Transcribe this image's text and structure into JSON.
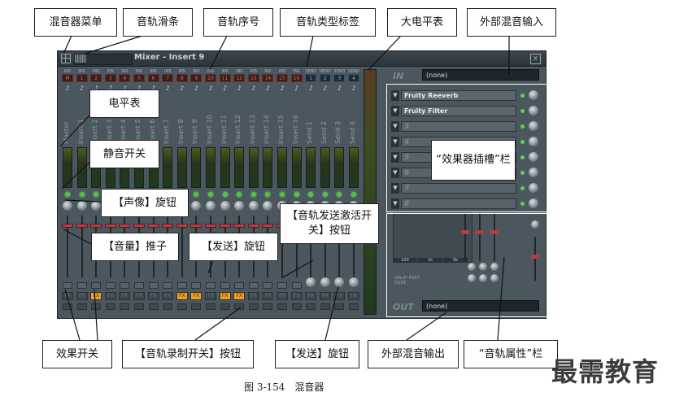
{
  "window": {
    "title": "Mixer - Insert 9",
    "close_glyph": "x",
    "menu_icon": "mixer-menu-icon"
  },
  "strips": [
    {
      "ins": "INS",
      "num": "M",
      "name": "Master",
      "send": false,
      "fx": false
    },
    {
      "ins": "INS",
      "num": "1",
      "name": "Insert 1",
      "send": false,
      "fx": false
    },
    {
      "ins": "INS",
      "num": "2",
      "name": "Insert 2",
      "send": false,
      "fx": true
    },
    {
      "ins": "INS",
      "num": "3",
      "name": "Insert 3",
      "send": false,
      "fx": false
    },
    {
      "ins": "INS",
      "num": "4",
      "name": "Insert 4",
      "send": false,
      "fx": false
    },
    {
      "ins": "INS",
      "num": "5",
      "name": "Insert 5",
      "send": false,
      "fx": false
    },
    {
      "ins": "INS",
      "num": "6",
      "name": "Insert 6",
      "send": false,
      "fx": false
    },
    {
      "ins": "INS",
      "num": "7",
      "name": "Insert 7",
      "send": false,
      "fx": false
    },
    {
      "ins": "INS",
      "num": "8",
      "name": "Insert 8",
      "send": false,
      "fx": true
    },
    {
      "ins": "INS",
      "num": "9",
      "name": "Insert 9",
      "send": false,
      "fx": true
    },
    {
      "ins": "INS",
      "num": "10",
      "name": "Insert 10",
      "send": false,
      "fx": false
    },
    {
      "ins": "INS",
      "num": "11",
      "name": "Insert 11",
      "send": false,
      "fx": true
    },
    {
      "ins": "INS",
      "num": "12",
      "name": "Insert 12",
      "send": false,
      "fx": true
    },
    {
      "ins": "INS",
      "num": "13",
      "name": "Insert 13",
      "send": false,
      "fx": false
    },
    {
      "ins": "INS",
      "num": "14",
      "name": "Insert 14",
      "send": false,
      "fx": false
    },
    {
      "ins": "INS",
      "num": "15",
      "name": "Insert 15",
      "send": false,
      "fx": false
    },
    {
      "ins": "INS",
      "num": "16",
      "name": "Insert 16",
      "send": false,
      "fx": false
    },
    {
      "ins": "SEND",
      "num": "1",
      "name": "Send 1",
      "send": true,
      "fx": false
    },
    {
      "ins": "SEND",
      "num": "2",
      "name": "Send 2",
      "send": true,
      "fx": false
    },
    {
      "ins": "SEND",
      "num": "3",
      "name": "Send 3",
      "send": true,
      "fx": false
    },
    {
      "ins": "SEND",
      "num": "4",
      "name": "Send 4",
      "send": true,
      "fx": false
    }
  ],
  "fx_label": "FX",
  "right_panel": {
    "in_label": "IN",
    "in_value": "(none)",
    "out_label": "OUT",
    "out_value": "(none)",
    "slots": [
      "Fruity Reeverb",
      "Fruity Filter",
      "3",
      "4",
      "5",
      "6",
      "7",
      "8"
    ],
    "eq_bands": [
      "100",
      "1k",
      "5k"
    ],
    "delay_text": "DELAY POST",
    "mode_text": "DUDE"
  },
  "annotations": {
    "mixer_menu": "混音器菜单",
    "track_slider": "音轨滑条",
    "track_number": "音轨序号",
    "track_type_label": "音轨类型标签",
    "big_meter": "大电平表",
    "external_input": "外部混音输入",
    "level_meter": "电平表",
    "mute_switch": "静音开关",
    "pan_knob": "【声像】旋钮",
    "volume_fader": "【音量】推子",
    "send_knob_top": "【发送】旋钮",
    "send_activate": "【音轨发送激活开关】按钮",
    "effect_slots": "“效果器插槽”栏",
    "effect_switch": "效果开关",
    "record_switch": "【音轨录制开关】按钮",
    "send_knob_bottom": "【发送】旋钮",
    "external_output": "外部混音输出",
    "track_properties": "“音轨属性”栏"
  },
  "caption": "图 3-154　混音器",
  "watermark": "最需教育"
}
